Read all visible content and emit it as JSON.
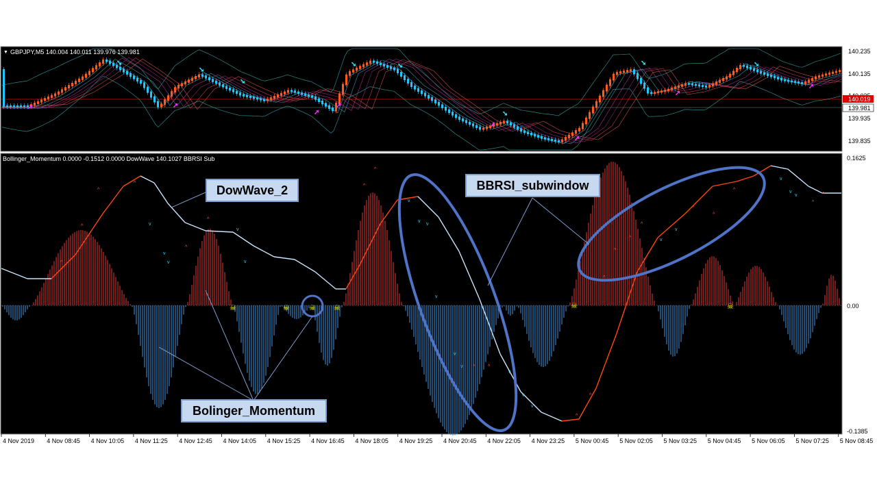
{
  "main_window": {
    "symbol_header": "GBPJPY,M5  140.004 140.011 139.976 139.981",
    "price_axis": [
      "140.235",
      "140.135",
      "140.035",
      "139.935",
      "139.835"
    ],
    "current_price": "139.981",
    "red_line_price": "140.019"
  },
  "sub_window": {
    "header": "Bollinger_Momentum 0.0000 -0.1512 0.0000  DowWave 140.1027  BBRSI Sub",
    "axis": [
      "0.1625",
      "0.00",
      "-0.1385"
    ]
  },
  "time_axis": [
    "4 Nov 2019",
    "4 Nov 08:45",
    "4 Nov 10:05",
    "4 Nov 11:25",
    "4 Nov 12:45",
    "4 Nov 14:05",
    "4 Nov 15:25",
    "4 Nov 16:45",
    "4 Nov 18:05",
    "4 Nov 19:25",
    "4 Nov 20:45",
    "4 Nov 22:05",
    "4 Nov 23:25",
    "5 Nov 00:45",
    "5 Nov 02:05",
    "5 Nov 03:25",
    "5 Nov 04:45",
    "5 Nov 06:05",
    "5 Nov 07:25",
    "5 Nov 08:45"
  ],
  "annotations": {
    "dowwave": "DowWave_2",
    "bbrsi": "BBRSI_subwindow",
    "momentum": "Bolinger_Momentum"
  },
  "colors": {
    "background": "#000000",
    "bull_candle": "#ff5a1e",
    "bear_candle": "#1ec8ff",
    "momentum_pos": "#d23232",
    "momentum_neg": "#3c8cd2",
    "wave_up": "#ff4614",
    "wave_down": "#c8e6ff",
    "highlight": "#4f74c7",
    "arrow_up": "#ff32ff",
    "arrow_down": "#32e6ff",
    "signal_icon": "#ffff00"
  }
}
